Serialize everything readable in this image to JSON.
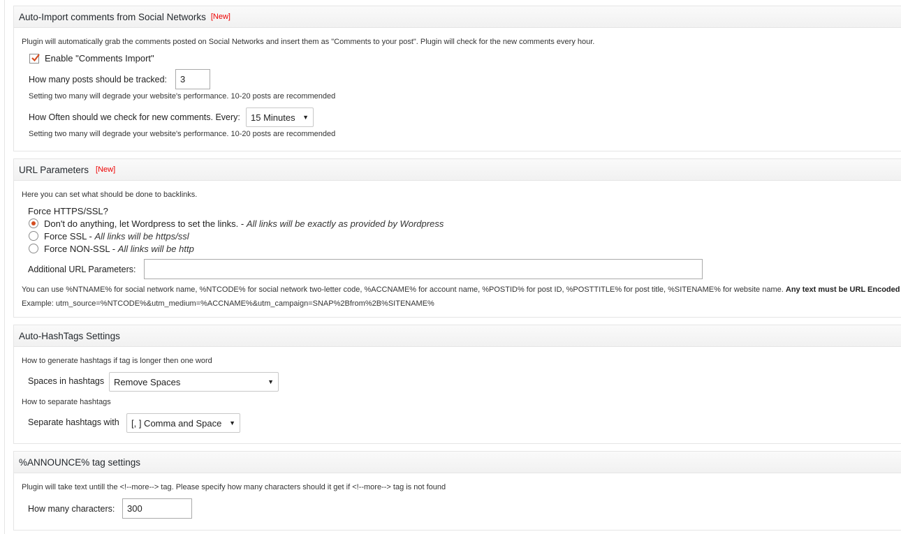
{
  "comments_import": {
    "title": "Auto-Import comments from Social Networks",
    "new_badge": "[New]",
    "description": "Plugin will automatically grab the comments posted on Social Networks and insert them as \"Comments to your post\". Plugin will check for the new comments every hour.",
    "enable_label": "Enable \"Comments Import\"",
    "enable_checked": true,
    "posts_tracked_label": "How many posts should be tracked:",
    "posts_tracked_value": "3",
    "posts_tracked_note": "Setting two many will degrade your website's performance. 10-20 posts are recommended",
    "check_every_label": "How Often should we check for new comments. Every:",
    "check_every_value": "15 Minutes",
    "check_every_note": "Setting two many will degrade your website's performance. 10-20 posts are recommended"
  },
  "url_params": {
    "title": "URL Parameters",
    "new_badge": "[New]",
    "description": "Here you can set what should be done to backlinks.",
    "force_label": "Force HTTPS/SSL?",
    "options": [
      {
        "label": "Don't do anything, let Wordpress to set the links. - ",
        "note": "All links will be exactly as provided by Wordpress",
        "selected": true
      },
      {
        "label": "Force SSL - ",
        "note": "All links will be https/ssl",
        "selected": false
      },
      {
        "label": "Force NON-SSL - ",
        "note": "All links will be http",
        "selected": false
      }
    ],
    "additional_label": "Additional URL Parameters:",
    "additional_value": "",
    "help_text": "You can use %NTNAME% for social network name, %NTCODE% for social network two-letter code, %ACCNAME% for account name, %POSTID% for post ID, %POSTTITLE% for post title, %SITENAME% for website name.",
    "help_bold": "Any text must be URL Encoded",
    "example": "Example: utm_source=%NTCODE%&utm_medium=%ACCNAME%&utm_campaign=SNAP%2Bfrom%2B%SITENAME%"
  },
  "hashtags": {
    "title": "Auto-HashTags Settings",
    "generate_note": "How to generate hashtags if tag is longer then one word",
    "spaces_label": "Spaces in hashtags",
    "spaces_value": "Remove Spaces",
    "separate_note": "How to separate hashtags",
    "separate_label": "Separate hashtags with",
    "separate_value": "[, ] Comma and Space"
  },
  "announce": {
    "title": "%ANNOUNCE% tag settings",
    "description": "Plugin will take text untill the <!--more--> tag. Please specify how many characters should it get if <!--more--> tag is not found",
    "chars_label": "How many characters:",
    "chars_value": "300"
  },
  "colors": {
    "badge": "#e00000",
    "radio_selected": "#d54e21",
    "check": "#d54e21"
  }
}
